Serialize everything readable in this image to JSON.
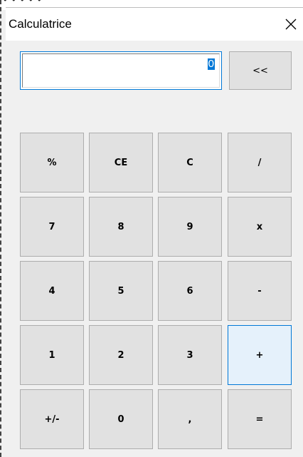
{
  "window": {
    "title": "Calculatrice",
    "close_glyph": "×"
  },
  "background_fragment": "• • • • •",
  "display": {
    "value": "0"
  },
  "backspace_label": "<<",
  "keys": [
    [
      "%",
      "CE",
      "C",
      "/"
    ],
    [
      "7",
      "8",
      "9",
      "x"
    ],
    [
      "4",
      "5",
      "6",
      "-"
    ],
    [
      "1",
      "2",
      "3",
      "+"
    ],
    [
      "+/-",
      "0",
      ",",
      "="
    ]
  ],
  "colors": {
    "accent": "#0078d7",
    "button_face": "#e1e1e1",
    "button_focused": "#e5f1fb",
    "window_bg": "#f0f0f0"
  },
  "icons": {
    "close": "close-icon"
  }
}
